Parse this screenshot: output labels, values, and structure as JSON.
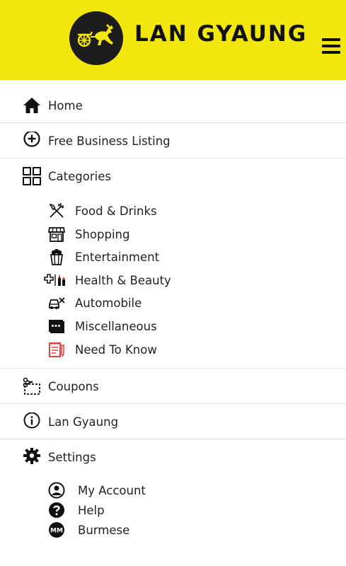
{
  "header": {
    "brand": "LAN GYAUNG",
    "colors": {
      "background": "#f2e60f",
      "logo_circle": "#1d1d1d",
      "logo_mark": "#f2e60f"
    },
    "icons": {
      "logo": "horse-cart-logo",
      "menu": "hamburger-icon"
    }
  },
  "menu": {
    "home": {
      "label": "Home",
      "icon": "home-icon"
    },
    "listing": {
      "label": "Free Business Listing",
      "icon": "plus-circle-icon"
    },
    "categories": {
      "label": "Categories",
      "icon": "grid-icon",
      "items": [
        {
          "label": "Food & Drinks",
          "icon": "fork-knife-icon"
        },
        {
          "label": "Shopping",
          "icon": "storefront-icon"
        },
        {
          "label": "Entertainment",
          "icon": "popcorn-icon"
        },
        {
          "label": "Health & Beauty",
          "icon": "health-beauty-icon"
        },
        {
          "label": "Automobile",
          "icon": "car-wrench-icon"
        },
        {
          "label": "Miscellaneous",
          "icon": "more-dots-icon"
        },
        {
          "label": "Need To Know",
          "icon": "notepad-icon",
          "color": "#e03030"
        }
      ]
    },
    "coupons": {
      "label": "Coupons",
      "icon": "scissors-coupon-icon"
    },
    "about": {
      "label": "Lan Gyaung",
      "icon": "info-icon"
    },
    "settings": {
      "label": "Settings",
      "icon": "gear-icon",
      "items": [
        {
          "label": "My Account",
          "icon": "user-circle-icon"
        },
        {
          "label": "Help",
          "icon": "question-icon"
        },
        {
          "label": "Burmese",
          "icon": "mm-language-icon",
          "badge": "MM"
        }
      ]
    }
  }
}
